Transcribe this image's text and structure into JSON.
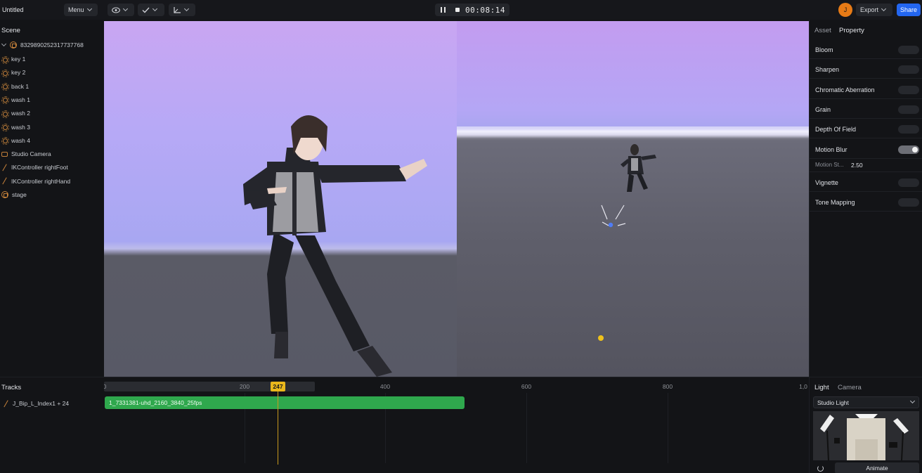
{
  "app": {
    "doc_title": "Untitled"
  },
  "toolbar": {
    "menu_label": "Menu",
    "timecode": "00:08:14",
    "avatar_initial": "J",
    "export_label": "Export",
    "share_label": "Share",
    "accent_color": "#2366f0"
  },
  "scene": {
    "title": "Scene",
    "root_item": "8329890252317737768",
    "items": [
      {
        "label": "key 1",
        "icon": "light-icon"
      },
      {
        "label": "key 2",
        "icon": "light-icon"
      },
      {
        "label": "back 1",
        "icon": "light-icon"
      },
      {
        "label": "wash 1",
        "icon": "light-icon"
      },
      {
        "label": "wash 2",
        "icon": "light-icon"
      },
      {
        "label": "wash 3",
        "icon": "light-icon"
      },
      {
        "label": "wash 4",
        "icon": "light-icon"
      },
      {
        "label": "Studio Camera",
        "icon": "camera-icon"
      },
      {
        "label": "IKController rightFoot",
        "icon": "bone-icon"
      },
      {
        "label": "IKController rightHand",
        "icon": "bone-icon"
      },
      {
        "label": "stage",
        "icon": "mesh-icon"
      }
    ]
  },
  "properties": {
    "tabs": [
      "Asset",
      "Property"
    ],
    "active_tab": "Property",
    "effects": [
      {
        "label": "Bloom",
        "enabled": false
      },
      {
        "label": "Sharpen",
        "enabled": false
      },
      {
        "label": "Chromatic Aberration",
        "enabled": false
      },
      {
        "label": "Grain",
        "enabled": false
      },
      {
        "label": "Depth Of Field",
        "enabled": false
      },
      {
        "label": "Motion Blur",
        "enabled": true
      }
    ],
    "motion_strength": {
      "label": "Motion St...",
      "value": "2.50"
    },
    "effects_after": [
      {
        "label": "Vignette",
        "enabled": false
      },
      {
        "label": "Tone Mapping",
        "enabled": false
      }
    ]
  },
  "tracks": {
    "title": "Tracks",
    "track_label": "J_Bip_L_Index1 + 24",
    "clip_label": "1_7331381-uhd_2160_3840_25fps",
    "clip_color": "#2fa84d",
    "playhead_frame": "247",
    "playhead_color": "#e9b71c",
    "ruler_ticks": [
      "0",
      "200",
      "400",
      "600",
      "800",
      "1,0"
    ]
  },
  "light_panel": {
    "tabs": [
      "Light",
      "Camera"
    ],
    "active_tab": "Light",
    "preset": "Studio Light",
    "animate_label": "Animate"
  }
}
